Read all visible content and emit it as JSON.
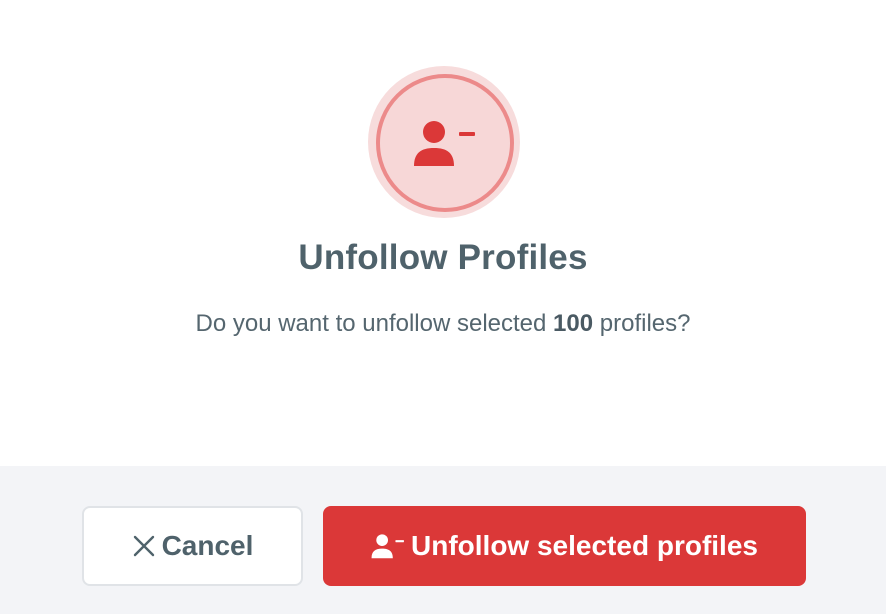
{
  "dialog": {
    "icon": "user-minus-icon",
    "title": "Unfollow Profiles",
    "message_prefix": "Do you want to unfollow selected ",
    "count": "100",
    "message_suffix": " profiles?"
  },
  "actions": {
    "cancel_label": "Cancel",
    "cancel_icon": "close-icon",
    "confirm_label": "Unfollow selected profiles",
    "confirm_icon": "user-minus-icon"
  },
  "colors": {
    "danger": "#db3838",
    "icon_ring": "#ec8a8a",
    "icon_bg": "#f7d7d7",
    "text": "#4f626b",
    "footer_bg": "#f3f4f7"
  }
}
